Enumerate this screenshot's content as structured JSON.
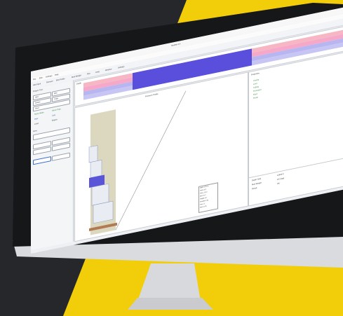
{
  "background": {
    "dark": "#26272b",
    "yellow": "#f2cd0a"
  },
  "app": {
    "window_title": "Strathin 3.4",
    "menu": [
      "File",
      "Edit",
      "Settings",
      "Help"
    ],
    "tabs": [
      "Project",
      "Pores"
    ],
    "ribbon": [
      "Add Input",
      "Remove",
      "Edit Profile",
      "Mud Weight",
      "Plot",
      "Units",
      "Window",
      "Settings"
    ]
  },
  "left_panel": {
    "header": "Project Tree",
    "buttons": [
      "Add",
      "Edit",
      "Delete",
      "Copy",
      "Save"
    ],
    "options": [
      "Show Wells",
      "Show Tops",
      "Hide",
      "Calc",
      "Load",
      "Export"
    ],
    "group_label": "View"
  },
  "top_chart": {
    "label": "Depth",
    "bands": [
      "#f7b6c4",
      "#f5a8c8",
      "#b8b6f0",
      "#5a4fdc"
    ]
  },
  "main_view": {
    "title": "Pressure Profile",
    "legend_items": [
      "Depth 1200 ft",
      "Temp 32.1",
      "Press 112.0",
      "Mud 10.2",
      "Weight 9.8",
      "Gradient 0.52",
      "Frac 1.1",
      "Max 12.05"
    ]
  },
  "right_panel": {
    "header": "Properties",
    "rows": [
      "Casing",
      "Liner",
      "Tubing",
      "Formation",
      "Fluid",
      "Pump"
    ],
    "footer_rows": [
      "Depth Total",
      "Mud Weight",
      "Result"
    ],
    "footer_values": [
      "12450 ft",
      "10.2 ppg",
      "OK"
    ]
  }
}
